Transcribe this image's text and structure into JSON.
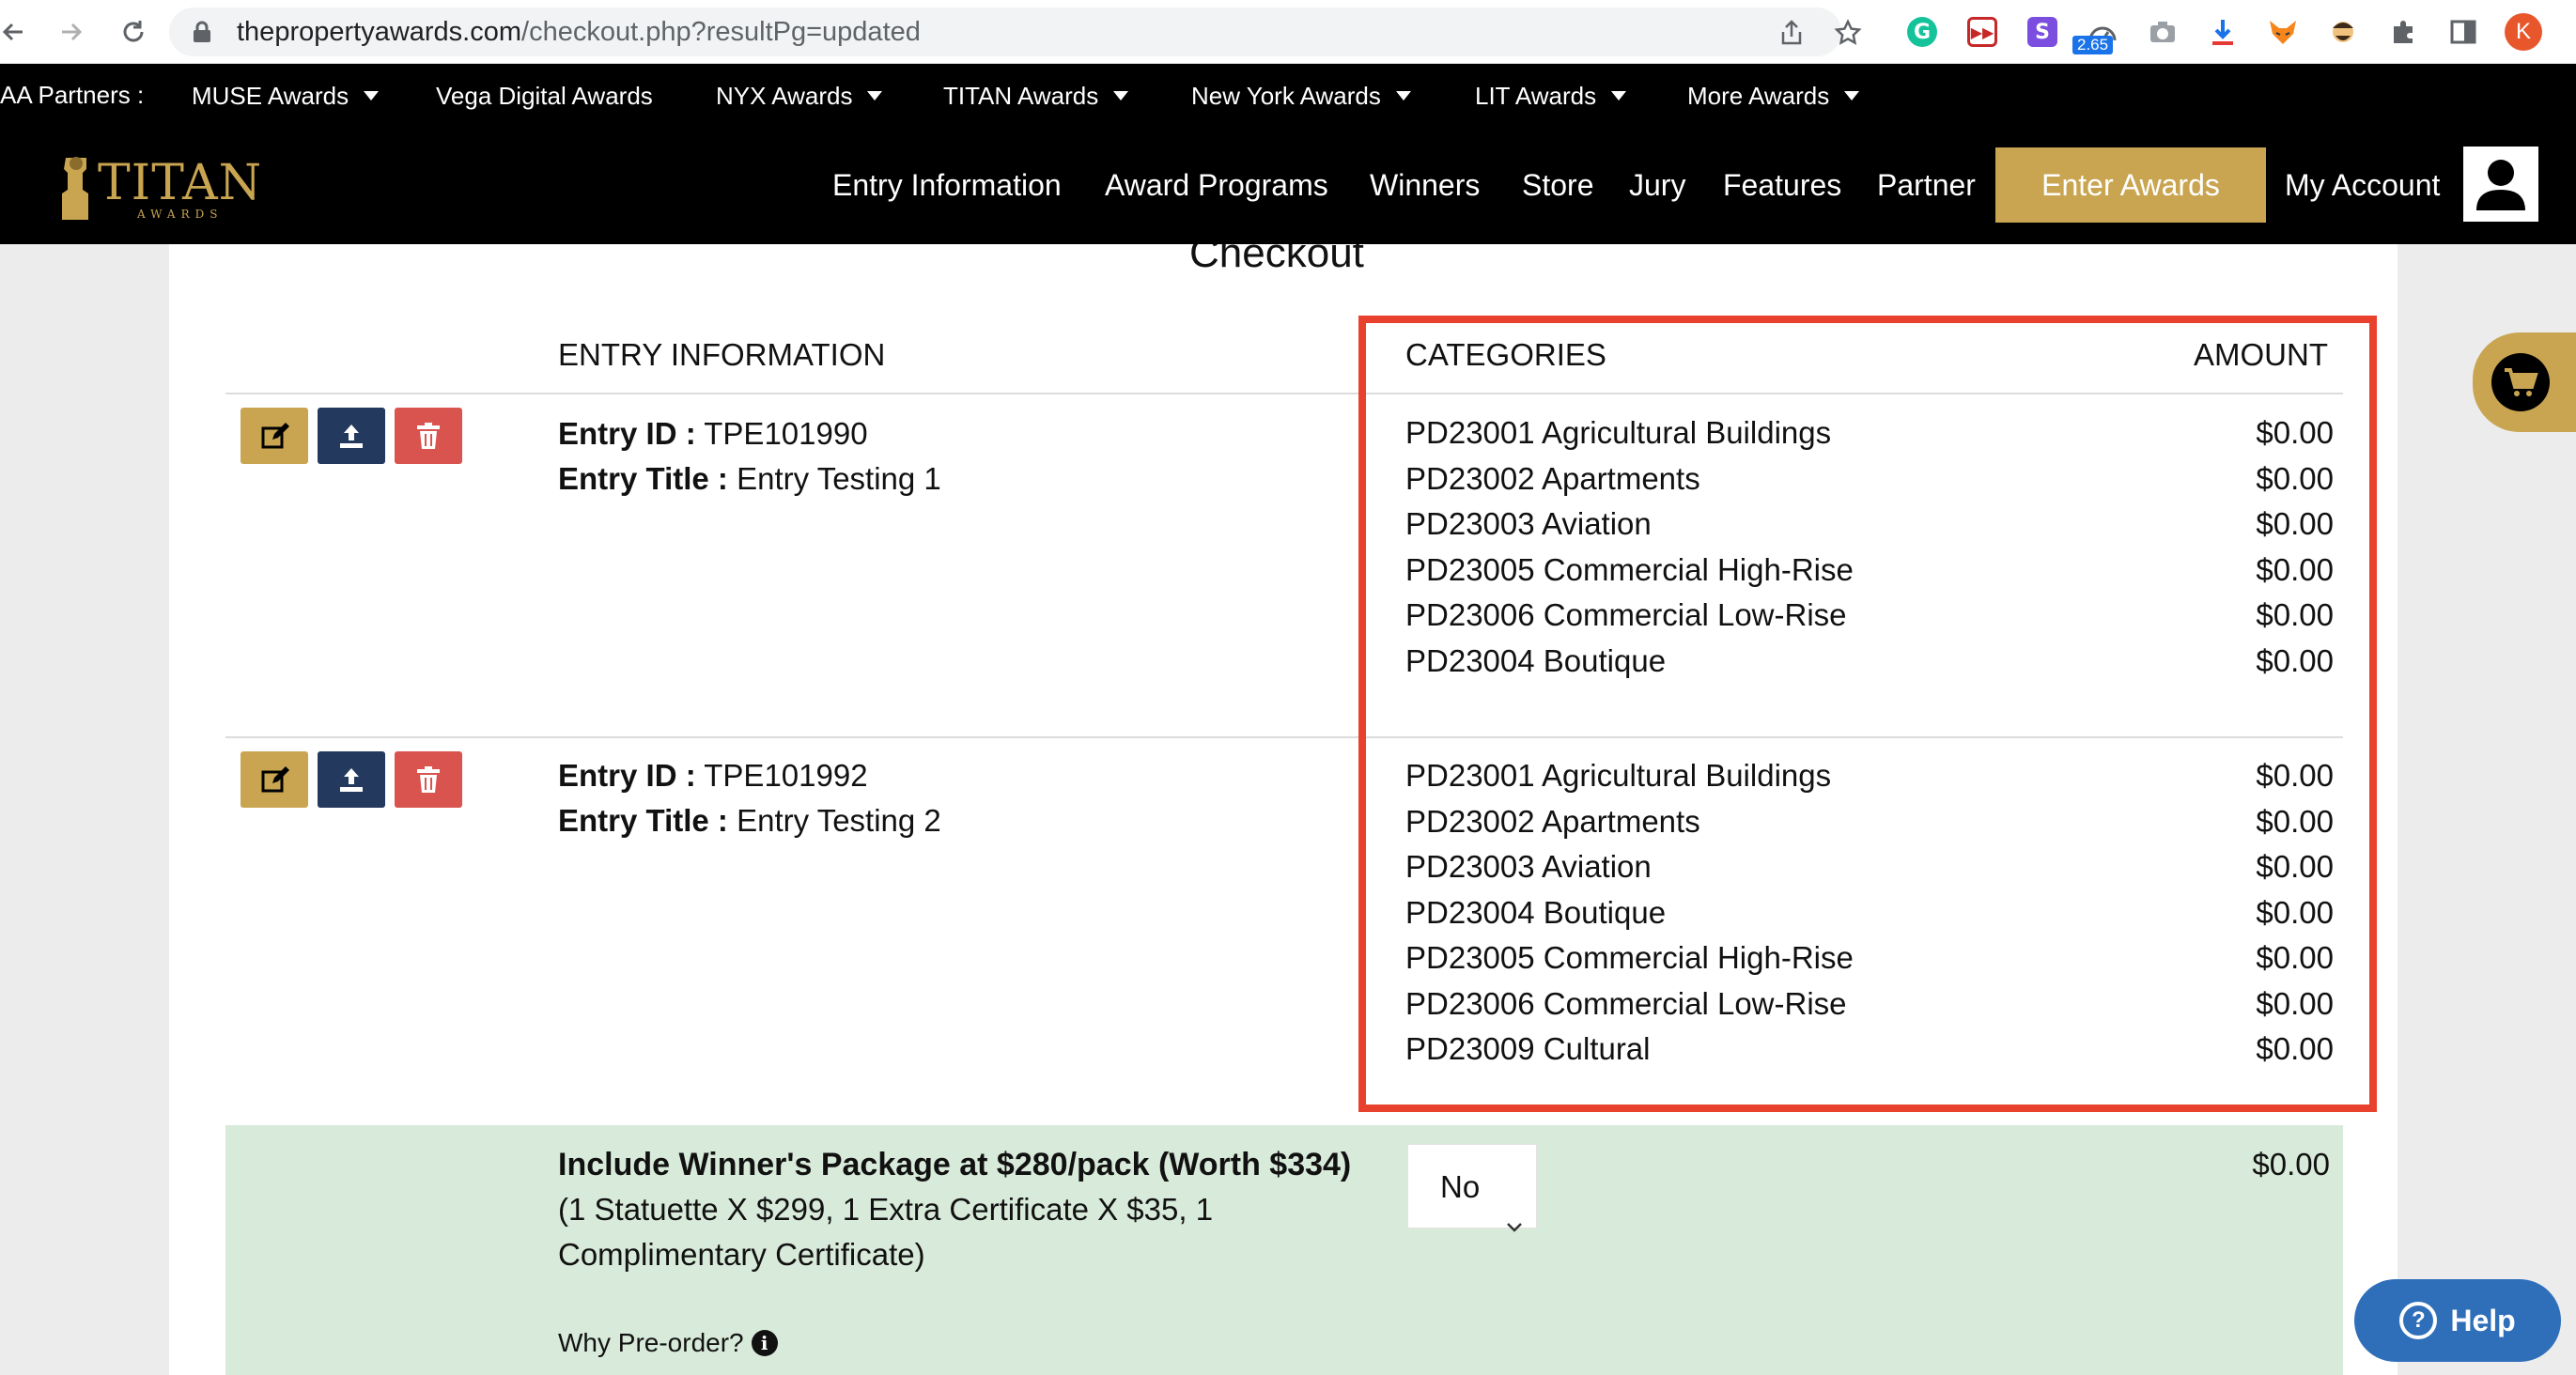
{
  "browser": {
    "url_domain": "thepropertyawards.com",
    "url_path": "/checkout.php?resultPg=updated",
    "extension_badge": "2.65",
    "profile_initial": "K"
  },
  "partners_bar": {
    "label": "AA Partners :",
    "items": [
      "MUSE Awards",
      "Vega Digital Awards",
      "NYX Awards",
      "TITAN Awards",
      "New York Awards",
      "LIT Awards",
      "More Awards"
    ]
  },
  "header": {
    "logo_text": "TITAN",
    "logo_subtext": "AWARDS",
    "nav": [
      "Entry Information",
      "Award Programs",
      "Winners",
      "Store",
      "Jury",
      "Features",
      "Partner"
    ],
    "enter_button": "Enter Awards",
    "account_link": "My Account"
  },
  "page": {
    "title": "Checkout",
    "columns": {
      "entry_info": "ENTRY INFORMATION",
      "categories": "CATEGORIES",
      "amount": "AMOUNT"
    },
    "id_label": "Entry ID :",
    "title_label": "Entry Title :",
    "entries": [
      {
        "entry_id": "TPE101990",
        "entry_title": "Entry Testing 1",
        "categories": [
          {
            "name": "PD23001 Agricultural Buildings",
            "amount": "$0.00"
          },
          {
            "name": "PD23002 Apartments",
            "amount": "$0.00"
          },
          {
            "name": "PD23003 Aviation",
            "amount": "$0.00"
          },
          {
            "name": "PD23005 Commercial High-Rise",
            "amount": "$0.00"
          },
          {
            "name": "PD23006 Commercial Low-Rise",
            "amount": "$0.00"
          },
          {
            "name": "PD23004 Boutique",
            "amount": "$0.00"
          }
        ]
      },
      {
        "entry_id": "TPE101992",
        "entry_title": "Entry Testing 2",
        "categories": [
          {
            "name": "PD23001 Agricultural Buildings",
            "amount": "$0.00"
          },
          {
            "name": "PD23002 Apartments",
            "amount": "$0.00"
          },
          {
            "name": "PD23003 Aviation",
            "amount": "$0.00"
          },
          {
            "name": "PD23004 Boutique",
            "amount": "$0.00"
          },
          {
            "name": "PD23005 Commercial High-Rise",
            "amount": "$0.00"
          },
          {
            "name": "PD23006 Commercial Low-Rise",
            "amount": "$0.00"
          },
          {
            "name": "PD23009 Cultural",
            "amount": "$0.00"
          }
        ]
      }
    ],
    "winner_package": {
      "title": "Include Winner's Package at $280/pack (Worth $334)",
      "description": "(1 Statuette X $299, 1 Extra Certificate X $35, 1 Complimentary Certificate)",
      "select_value": "No",
      "amount": "$0.00",
      "why_link": "Why Pre-order?"
    }
  },
  "help_button": "Help",
  "colors": {
    "gold": "#c9a551",
    "navy": "#23395d",
    "red": "#d9534f",
    "highlight": "#e8412d",
    "package_bg": "#d8ead9"
  }
}
